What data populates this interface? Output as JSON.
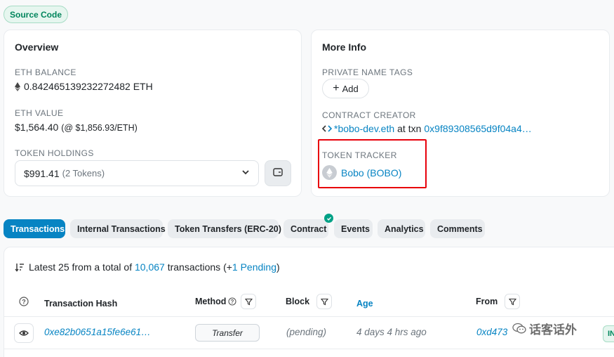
{
  "source_code_badge": "Source Code",
  "overview": {
    "title": "Overview",
    "eth_balance_label": "ETH BALANCE",
    "eth_balance_value": "0.842465139232272482 ETH",
    "eth_value_label": "ETH VALUE",
    "eth_value_amount": "$1,564.40",
    "eth_value_rate": "(@ $1,856.93/ETH)",
    "token_holdings_label": "TOKEN HOLDINGS",
    "token_holdings_value": "$991.41",
    "token_holdings_count": "(2 Tokens)"
  },
  "more_info": {
    "title": "More Info",
    "private_tags_label": "PRIVATE NAME TAGS",
    "add_label": "Add",
    "contract_creator_label": "CONTRACT CREATOR",
    "creator_name": "*bobo-dev.eth",
    "creator_at_txn": "at txn",
    "creator_txn": "0x9f89308565d9f04a4…",
    "token_tracker_label": "TOKEN TRACKER",
    "token_tracker_value": "Bobo (BOBO)"
  },
  "tabs": [
    {
      "label": "Transactions",
      "active": true
    },
    {
      "label": "Internal Transactions",
      "active": false
    },
    {
      "label": "Token Transfers (ERC-20)",
      "active": false
    },
    {
      "label": "Contract",
      "active": false
    },
    {
      "label": "Events",
      "active": false
    },
    {
      "label": "Analytics",
      "active": false
    },
    {
      "label": "Comments",
      "active": false
    }
  ],
  "transactions": {
    "summary_prefix": "Latest 25 from a total of",
    "total": "10,067",
    "summary_mid": "transactions (+",
    "pending": "1 Pending",
    "summary_suffix": ")",
    "columns": {
      "hash": "Transaction Hash",
      "method": "Method",
      "block": "Block",
      "age": "Age",
      "from": "From"
    },
    "rows": [
      {
        "hash": "0xe82b0651a15fe6e61…",
        "method": "Transfer",
        "block": "(pending)",
        "age": "4 days 4 hrs ago",
        "from": "0xd473",
        "direction": "IN"
      }
    ]
  },
  "watermark": "话客话外",
  "colors": {
    "accent": "#0784c3",
    "success": "#00a186",
    "highlight_border": "#e8000b"
  }
}
